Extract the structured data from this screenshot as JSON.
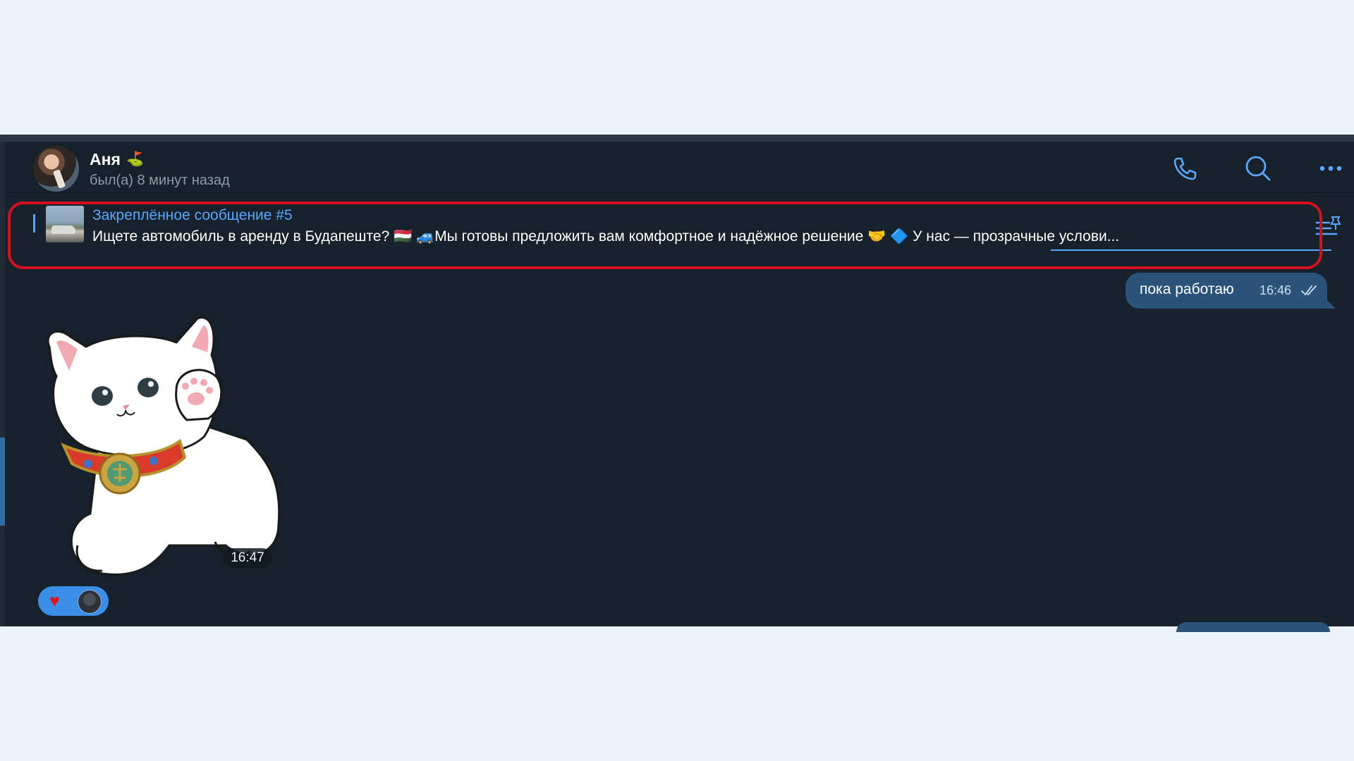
{
  "header": {
    "contact_name": "Аня",
    "status": "был(а) 8 минут назад"
  },
  "pinned": {
    "title": "Закреплённое сообщение #5",
    "text": "Ищете автомобиль в аренду в Будапеште? 🇭🇺 🚙Мы готовы предложить вам комфортное и надёжное решение 🤝   🔷 У нас — прозрачные услови..."
  },
  "messages": {
    "outgoing_text": "пока работаю",
    "outgoing_time": "16:46",
    "sticker_time": "16:47"
  },
  "reaction": {
    "emoji": "♥"
  },
  "icons": {
    "call": "phone-icon",
    "search": "search-icon",
    "menu": "more-dots-icon",
    "pinned_list": "pinned-list-icon",
    "read_status": "double-check-icon"
  },
  "colors": {
    "accent": "#5aa7ff",
    "window_bg": "#17212b",
    "outgoing_bubble": "#2b5278",
    "highlight": "#d2101f"
  }
}
